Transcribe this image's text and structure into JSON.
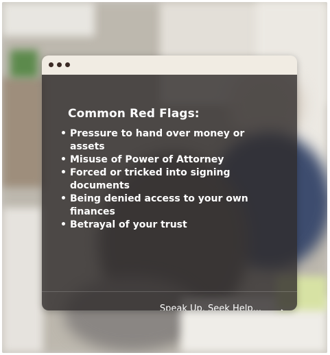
{
  "card": {
    "title": "Common Red Flags:",
    "flags": [
      "Pressure to hand over money or assets",
      "Misuse of Power of Attorney",
      "Forced or tricked into signing documents",
      "Being denied access to your own finances",
      "Betrayal of your trust"
    ],
    "cta_label": "Speak Up. Seek Help...",
    "cta_icon": "arrow-right-icon"
  },
  "colors": {
    "titlebar": "#f1ece3",
    "window_dots": "#3b2a25",
    "card_overlay": "#302c2c",
    "text": "#ffffff"
  }
}
